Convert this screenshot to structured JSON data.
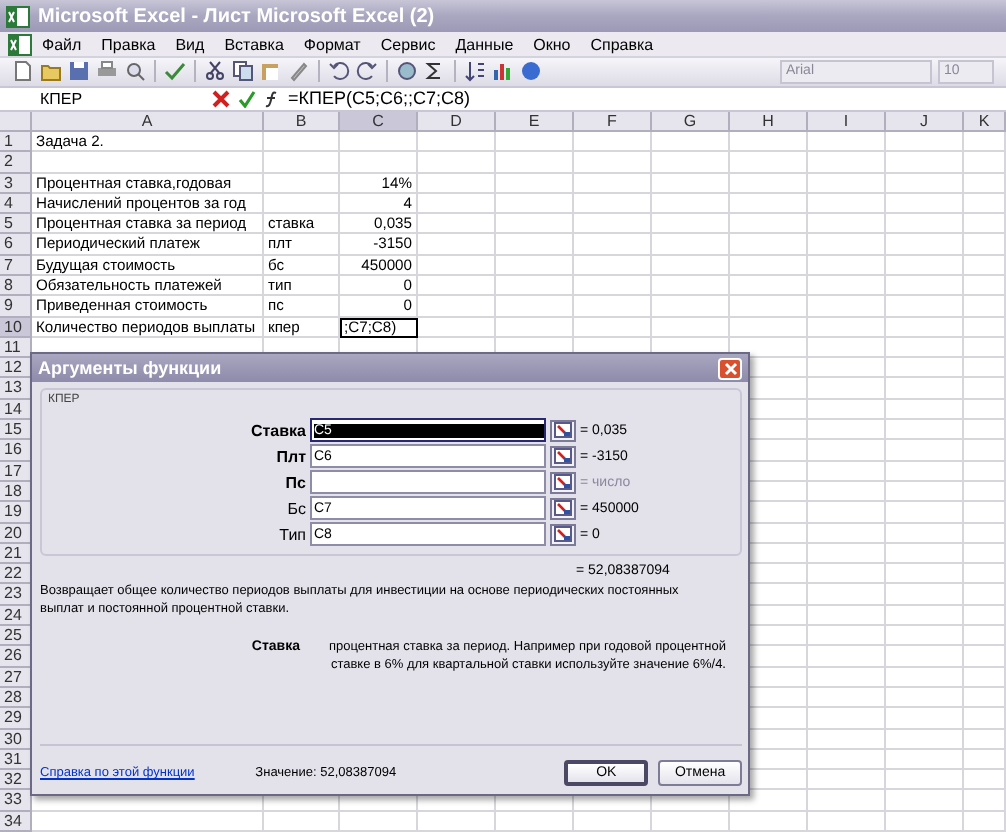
{
  "window": {
    "title": "Microsoft Excel - Лист Microsoft Excel (2)"
  },
  "menu": [
    "Файл",
    "Правка",
    "Вид",
    "Вставка",
    "Формат",
    "Сервис",
    "Данные",
    "Окно",
    "Справка"
  ],
  "toolbar": {
    "font": "Arial",
    "size": "10"
  },
  "formula_bar": {
    "name_box": "КПЕР",
    "formula": "=КПЕР(C5;C6;;C7;C8)"
  },
  "sheet": {
    "columns": [
      {
        "label": "A",
        "selected": false
      },
      {
        "label": "B",
        "selected": false
      },
      {
        "label": "C",
        "selected": true
      },
      {
        "label": "D",
        "selected": false
      },
      {
        "label": "E",
        "selected": false
      },
      {
        "label": "F",
        "selected": false
      },
      {
        "label": "G",
        "selected": false
      },
      {
        "label": "H",
        "selected": false
      },
      {
        "label": "I",
        "selected": false
      },
      {
        "label": "J",
        "selected": false
      },
      {
        "label": "K",
        "selected": false
      }
    ],
    "rows": [
      {
        "number": "1",
        "selected": false,
        "cells": [
          {
            "text": "Задача 2."
          }
        ]
      },
      {
        "number": "2",
        "selected": false
      },
      {
        "number": "3",
        "selected": false,
        "cells": [
          {
            "text": "Процентная ставка,годовая"
          },
          {},
          {
            "text": "14%"
          }
        ]
      },
      {
        "number": "4",
        "selected": false,
        "cells": [
          {
            "text": "Начислений процентов за год"
          },
          {},
          {
            "text": "4"
          }
        ]
      },
      {
        "number": "5",
        "selected": false,
        "cells": [
          {
            "text": "Процентная ставка за период"
          },
          {
            "text": "ставка"
          },
          {
            "text": "0,035"
          }
        ]
      },
      {
        "number": "6",
        "selected": false,
        "cells": [
          {
            "text": "Периодический платеж"
          },
          {
            "text": "плт"
          },
          {
            "text": "-3150"
          }
        ]
      },
      {
        "number": "7",
        "selected": false,
        "cells": [
          {
            "text": "Будущая стоимость"
          },
          {
            "text": "бс"
          },
          {
            "text": "450000"
          }
        ]
      },
      {
        "number": "8",
        "selected": false,
        "cells": [
          {
            "text": "Обязательность платежей"
          },
          {
            "text": "тип"
          },
          {
            "text": "0"
          }
        ]
      },
      {
        "number": "9",
        "selected": false,
        "cells": [
          {
            "text": "Приведенная стоимость"
          },
          {
            "text": "пс"
          },
          {
            "text": "0"
          }
        ]
      },
      {
        "number": "10",
        "selected": true,
        "cells": [
          {
            "text": "Количество периодов выплаты"
          },
          {
            "text": "кпер"
          },
          {
            "text": ";C7;C8)",
            "active": true
          }
        ]
      },
      {
        "number": "11",
        "selected": false
      },
      {
        "number": "12",
        "selected": false
      },
      {
        "number": "13",
        "selected": false
      },
      {
        "number": "14",
        "selected": false
      },
      {
        "number": "15",
        "selected": false
      },
      {
        "number": "16",
        "selected": false
      },
      {
        "number": "17",
        "selected": false
      },
      {
        "number": "18",
        "selected": false
      },
      {
        "number": "19",
        "selected": false
      },
      {
        "number": "20",
        "selected": false
      },
      {
        "number": "21",
        "selected": false
      },
      {
        "number": "22",
        "selected": false
      },
      {
        "number": "23",
        "selected": false
      },
      {
        "number": "24",
        "selected": false
      },
      {
        "number": "25",
        "selected": false
      },
      {
        "number": "26",
        "selected": false
      },
      {
        "number": "27",
        "selected": false
      },
      {
        "number": "28",
        "selected": false
      },
      {
        "number": "29",
        "selected": false
      },
      {
        "number": "30",
        "selected": false
      },
      {
        "number": "31",
        "selected": false
      },
      {
        "number": "32",
        "selected": false
      },
      {
        "number": "33",
        "selected": false
      },
      {
        "number": "34",
        "selected": false
      }
    ]
  },
  "dialog": {
    "title": "Аргументы функции",
    "group": "КПЕР",
    "args": [
      {
        "label": "Ставка",
        "required": true,
        "value": "C5",
        "selected": true,
        "result": "= 0,035",
        "hint": false
      },
      {
        "label": "Плт",
        "required": true,
        "value": "C6",
        "selected": false,
        "result": "= -3150",
        "hint": false
      },
      {
        "label": "Пс",
        "required": true,
        "selected": false,
        "result": "= число",
        "hint": true
      },
      {
        "label": "Бс",
        "required": false,
        "value": "C7",
        "selected": false,
        "result": "= 450000",
        "hint": false
      },
      {
        "label": "Тип",
        "required": false,
        "value": "C8",
        "selected": false,
        "result": "= 0",
        "hint": false
      }
    ],
    "total": "= 52,08387094",
    "description": "Возвращает общее количество периодов выплаты для инвестиции на основе периодических постоянных выплат и постоянной процентной ставки.",
    "arg_help": {
      "name": "Ставка",
      "text": "процентная ставка за период. Например при годовой процентной ставке в 6% для квартальной ставки используйте значение 6%/4."
    },
    "help_link": "Справка по этой функции",
    "value": "Значение: 52,08387094",
    "buttons": [
      {
        "label": "OK",
        "default": true
      },
      {
        "label": "Отмена",
        "default": false
      }
    ]
  }
}
